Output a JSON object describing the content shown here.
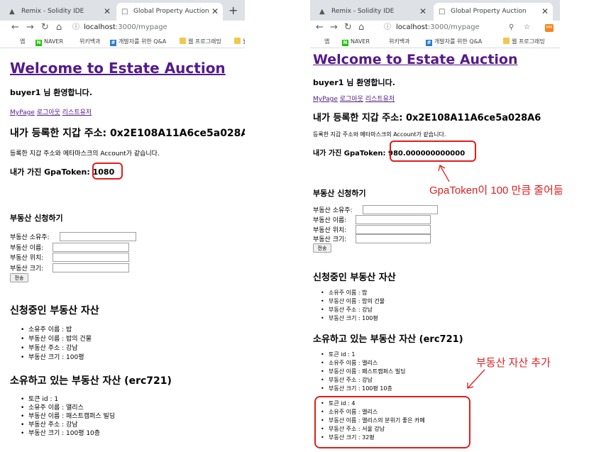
{
  "left": {
    "tabs": [
      {
        "icon": "remix-icon",
        "label": "Remix - Solidity IDE",
        "active": false
      },
      {
        "icon": "page-icon",
        "label": "Global Property Auction",
        "active": true
      }
    ],
    "url_host": "localhost",
    "url_path": ":3000/mypage",
    "bookmarks": [
      "앱",
      "NAVER",
      "위키백과",
      "개발자를 위한 Q&A",
      "웹 프로그래밍",
      "웹"
    ],
    "page": {
      "title": "Welcome to Estate Auction",
      "greeting": "buyer1 님 환영합니다.",
      "links": [
        "MyPage",
        "로그아웃",
        "리스트유저"
      ],
      "wallet_heading": "내가 등록한 지갑 주소: 0x2E108A11A6ce5a028A",
      "wallet_note": "등록한 지갑 주소와 메타마스크의 Account가 같습니다.",
      "token_label": "내가 가진 GpaToken:",
      "token_value": "1080",
      "apply_heading": "부동산 신청하기",
      "form_labels": [
        "부동산 소유주:",
        "부동산 이름:",
        "부동산 위치:",
        "부동산 크기:"
      ],
      "submit_label": "전송",
      "pending_heading": "신청중인 부동산 자산",
      "pending_items": [
        "소유주 이름 : 밥",
        "부동산 이름 : 밥의 건물",
        "부동산 주소 : 강남",
        "부동산 크기 : 100평"
      ],
      "owned_heading": "소유하고 있는 부동산 자산 (erc721)",
      "owned_items": [
        "토큰 id : 1",
        "소유주 이름 : 앨리스",
        "부동산 이름 : 패스트캠퍼스 빌딩",
        "부동산 주소 : 강남",
        "부동산 크기 : 100평 10층"
      ]
    }
  },
  "right": {
    "tabs": [
      {
        "icon": "remix-icon",
        "label": "Remix - Solidity IDE",
        "active": false
      },
      {
        "icon": "page-icon",
        "label": "Global Property Auction",
        "active": true
      }
    ],
    "url_host": "localhost",
    "url_path": ":3000/mypage",
    "extension_label": "MM",
    "bookmarks": [
      "앱",
      "NAVER",
      "위키백과",
      "개발자를 위한 Q&A",
      "웹 프로그래밍"
    ],
    "page": {
      "title": "Welcome to Estate Auction",
      "greeting": "buyer1 님 환영합니다.",
      "links": [
        "MyPage",
        "로그아웃",
        "리스트유저"
      ],
      "wallet_heading": "내가 등록한 지갑 주소: 0x2E108A11A6ce5a028A6",
      "wallet_note": "등록한 지갑 주소와 메타마스크의 Account가 같습니다.",
      "token_label": "내가 가진 GpaToken:",
      "token_value": "980.000000000000",
      "apply_heading": "부동산 신청하기",
      "form_labels": [
        "부동산 소유주:",
        "부동산 이름:",
        "부동산 위치:",
        "부동산 크기:"
      ],
      "submit_label": "전송",
      "pending_heading": "신청중인 부동산 자산",
      "pending_items": [
        "소유주 이름 : 밥",
        "부동산 이름 : 밥의 건물",
        "부동산 주소 : 강남",
        "부동산 크기 : 100평"
      ],
      "owned_heading": "소유하고 있는 부동산 자산 (erc721)",
      "owned_items": [
        "토큰 id : 1",
        "소유주 이름 : 앨리스",
        "부동산 이름 : 패스트캠퍼스 빌딩",
        "부동산 주소 : 강남",
        "부동산 크기 : 100평 10층"
      ],
      "owned_items_new": [
        "토큰 id : 4",
        "소유주 이름 : 앨리스",
        "부동산 이름 : 앨리스의 분위기 좋은 카페",
        "부동산 주소 : 서울 강남",
        "부동산 크기 : 32평"
      ]
    }
  },
  "annotations": {
    "token_decrease": "GpaToken이 100 만큼 줄어듦",
    "asset_added": "부동산 자산 추가",
    "color": "#e02020"
  }
}
